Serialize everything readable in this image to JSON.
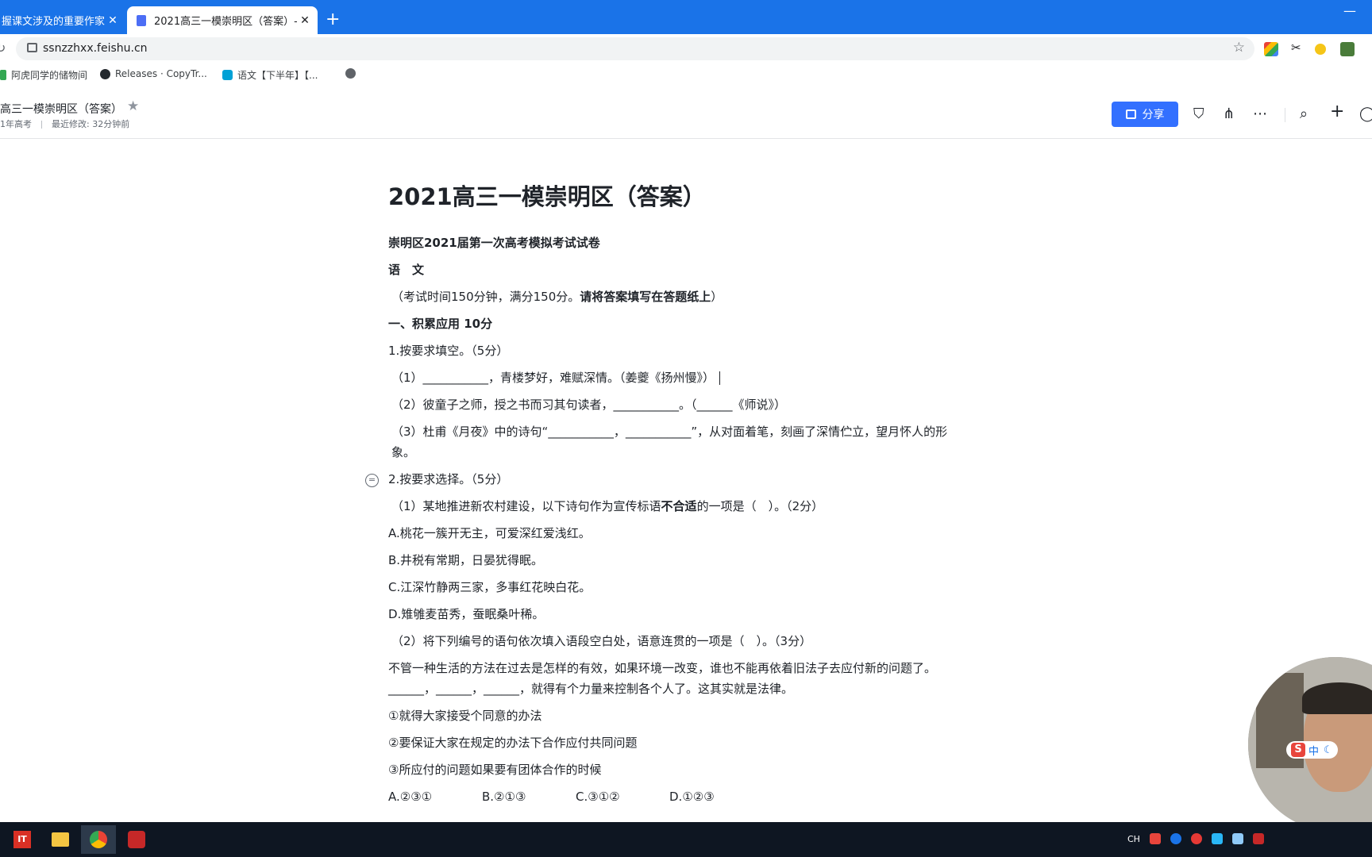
{
  "browser": {
    "tabs": [
      {
        "title": "握课文涉及的重要作家、(",
        "active": false
      },
      {
        "title": "2021高三一模崇明区（答案）-",
        "active": true
      }
    ],
    "url": "ssnzzhxx.feishu.cn",
    "bookmarks": [
      {
        "label": "阿虎同学的储物间",
        "icon": "bookmark-leaf-icon"
      },
      {
        "label": "Releases · CopyTr...",
        "icon": "github-icon"
      },
      {
        "label": "语文【下半年】【...",
        "icon": "bilibili-icon"
      },
      {
        "label": "",
        "icon": "globe-icon"
      }
    ]
  },
  "header": {
    "title": "高三一模崇明区（答案）",
    "folder": "1年高考",
    "last_modified": "最近修改: 32分钟前",
    "share_label": "分享"
  },
  "document": {
    "title": "2021高三一模崇明区（答案）",
    "paragraphs": {
      "exam_name": "崇明区2021届第一次高考模拟考试试卷",
      "subject": "语　文",
      "time_note_a": "（考试时间150分钟，满分150分。",
      "time_note_b": "请将答案填写在答题纸上",
      "time_note_c": "）",
      "section1": "一、积累应用  10分",
      "q1": "1.按要求填空。（5分）",
      "q1_1": "（1）___________，青楼梦好，难赋深情。（姜夔《扬州慢》）",
      "q1_2": "（2）彼童子之师，授之书而习其句读者，___________。（______《师说》）",
      "q1_3": "（3）杜甫《月夜》中的诗句“___________，___________”，从对面着笔，刻画了深情伫立，望月怀人的形象。",
      "q2": "2.按要求选择。（5分）",
      "q2_1a": "（1）某地推进新农村建设，以下诗句作为宣传标语",
      "q2_1b": "不合适",
      "q2_1c": "的一项是（　）。（2分）",
      "optA": "A.桃花一簇开无主，可爱深红爱浅红。",
      "optB": "B.井税有常期，日晏犹得眠。",
      "optC": "C.江深竹静两三家，多事红花映白花。",
      "optD": "D.雉雊麦苗秀，蚕眠桑叶稀。",
      "q2_2": "（2）将下列编号的语句依次填入语段空白处，语意连贯的一项是（　）。（3分）",
      "passage": "不管一种生活的方法在过去是怎样的有效，如果环境一改变，谁也不能再依着旧法子去应付新的问题了。______，______，______，就得有个力量来控制各个人了。这其实就是法律。",
      "s1": "①就得大家接受个同意的办法",
      "s2": "②要保证大家在规定的办法下合作应付共同问题",
      "s3": "③所应付的问题如果要有团体合作的时候",
      "choices": [
        "A.②③①",
        "B.②①③",
        "C.③①②",
        "D.①②③"
      ]
    }
  },
  "ime": {
    "label": "中"
  },
  "tray": {
    "lang": "CH"
  },
  "colors": {
    "chrome_blue": "#1a73e8",
    "feishu_blue": "#3370ff",
    "taskbar": "#0e1622"
  }
}
